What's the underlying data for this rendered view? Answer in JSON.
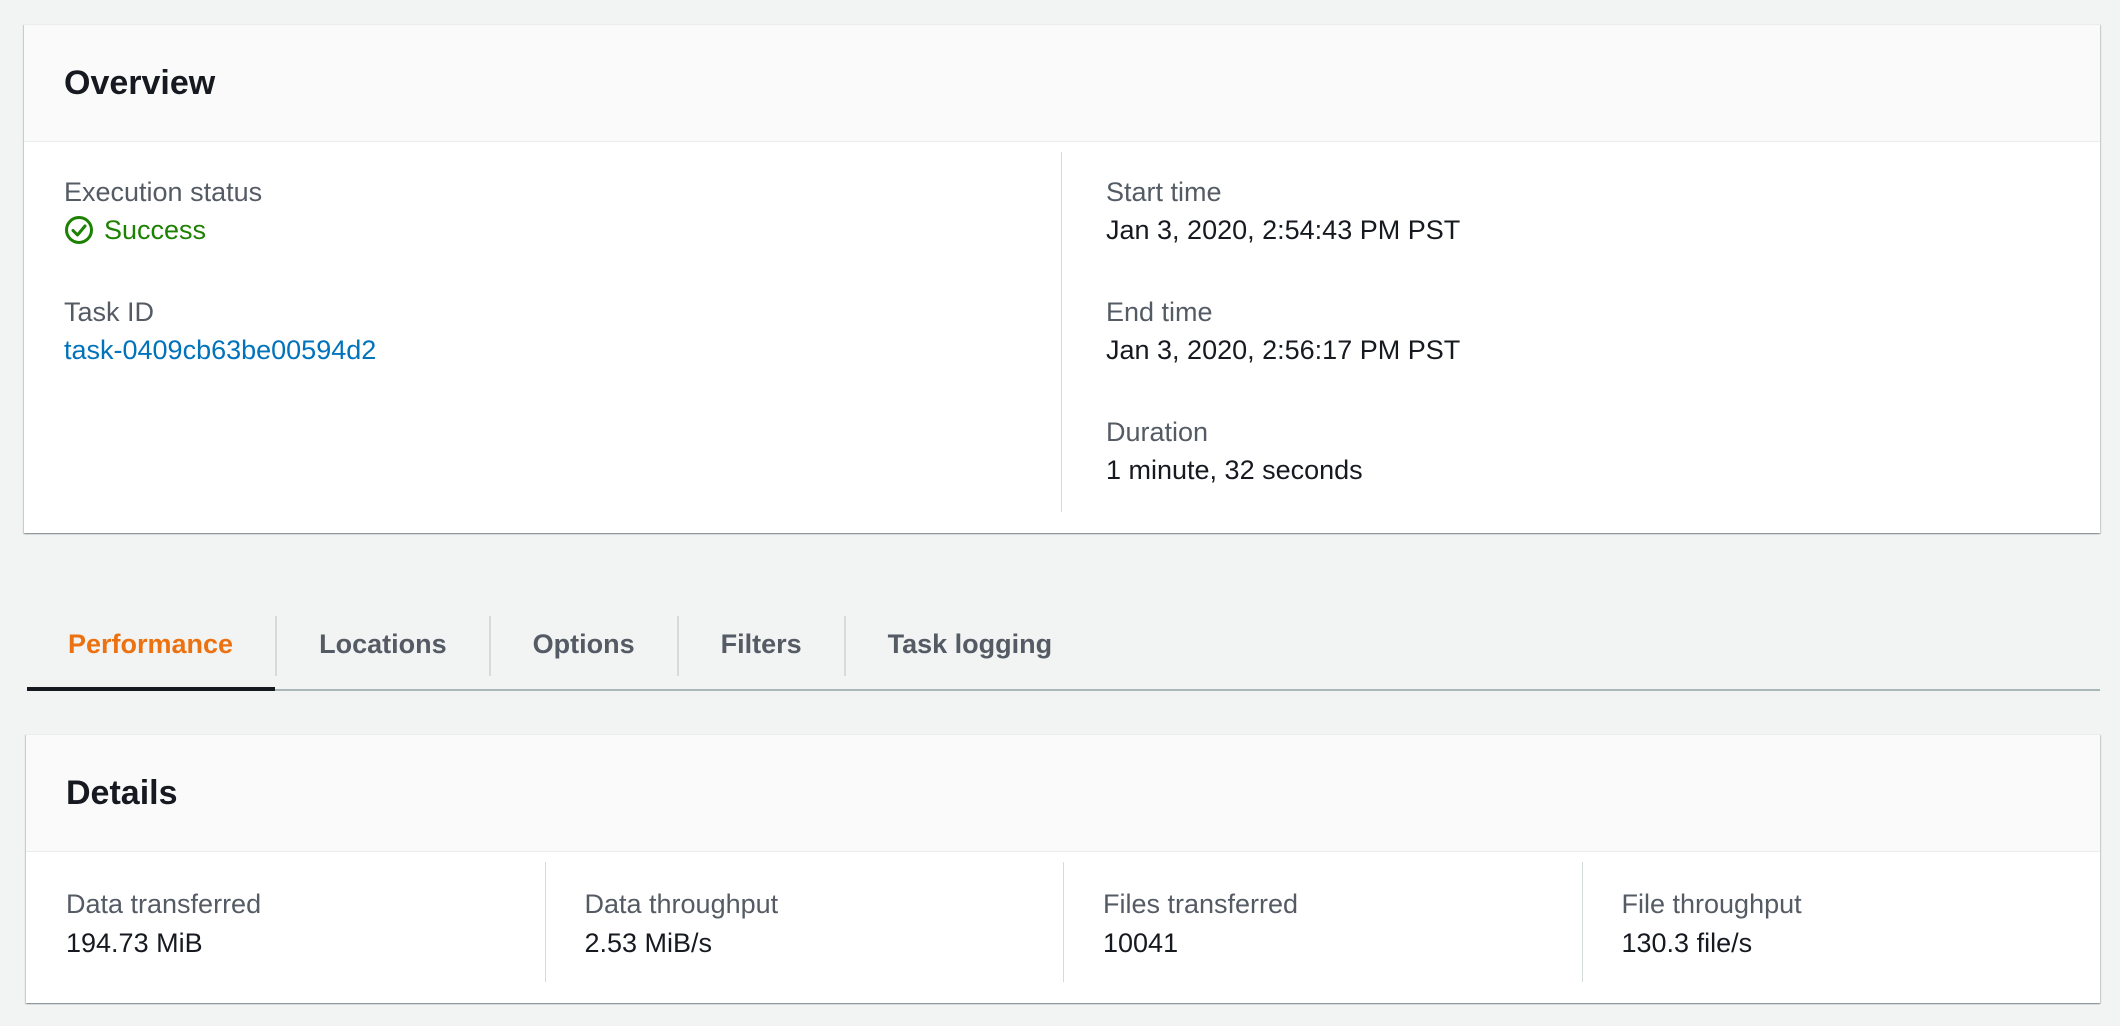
{
  "overview": {
    "title": "Overview",
    "execution_status": {
      "label": "Execution status",
      "value": "Success",
      "icon": "check-circle-icon",
      "color": "#1d8102"
    },
    "task_id": {
      "label": "Task ID",
      "value": "task-0409cb63be00594d2"
    },
    "start_time": {
      "label": "Start time",
      "value": "Jan 3, 2020, 2:54:43 PM PST"
    },
    "end_time": {
      "label": "End time",
      "value": "Jan 3, 2020, 2:56:17 PM PST"
    },
    "duration": {
      "label": "Duration",
      "value": "1 minute, 32 seconds"
    }
  },
  "tabs": [
    {
      "label": "Performance",
      "active": true
    },
    {
      "label": "Locations",
      "active": false
    },
    {
      "label": "Options",
      "active": false
    },
    {
      "label": "Filters",
      "active": false
    },
    {
      "label": "Task logging",
      "active": false
    }
  ],
  "details": {
    "title": "Details",
    "metrics": [
      {
        "label": "Data transferred",
        "value": "194.73 MiB"
      },
      {
        "label": "Data throughput",
        "value": "2.53 MiB/s"
      },
      {
        "label": "Files transferred",
        "value": "10041"
      },
      {
        "label": "File throughput",
        "value": "130.3 file/s"
      }
    ]
  },
  "colors": {
    "accent_active_tab": "#ec7211",
    "link": "#0073bb",
    "success": "#1d8102"
  }
}
